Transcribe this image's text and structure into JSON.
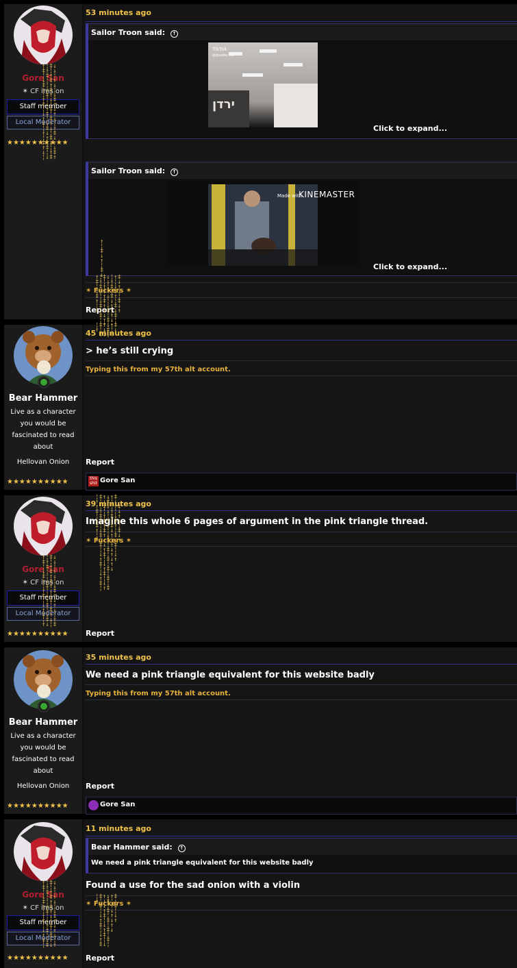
{
  "users": {
    "gore": {
      "name": "Gore San",
      "title": "CF ims on",
      "staff": "Staff member",
      "mod": "Local Moderator",
      "stars": "★★★★★★★★★★"
    },
    "bear": {
      "name": "Bear Hammer",
      "title_lines": [
        "Live as a character",
        "you would be",
        "fascinated to read",
        "about"
      ],
      "rank": "Hellovan Onion",
      "stars": "★★★★★★★★★★"
    }
  },
  "posts": [
    {
      "time": "53 minutes ago",
      "quotes": [
        {
          "author": "Sailor Troon said:",
          "expand": "Click to expand..."
        },
        {
          "author": "Sailor Troon said:",
          "expand": "Click to expand..."
        }
      ],
      "reaction": "✶ Fuckers ✶",
      "report": "Report"
    },
    {
      "time": "45 minutes ago",
      "body": "> he’s still crying",
      "signature": "Typing this from my 57th alt account.",
      "report": "Report",
      "reacted_by": "Gore San"
    },
    {
      "time": "39 minutes ago",
      "body": "Imagine this whole 6 pages of argument in the pink triangle thread.",
      "reaction": "✶ Fuckers ✶",
      "report": "Report"
    },
    {
      "time": "35 minutes ago",
      "body": "We need a pink triangle equivalent for this website badly",
      "signature": "Typing this from my 57th alt account.",
      "report": "Report",
      "reacted_by": "Gore San"
    },
    {
      "time": "11 minutes ago",
      "quote_author": "Bear Hammer said:",
      "quote_text": "We need a pink triangle equivalent for this website badly",
      "body": "Found a use for the sad onion with a violin",
      "reaction": "✶ Fuckers ✶",
      "report": "Report"
    }
  ],
  "video_overlay": "Made with KINEMASTER",
  "tiktok_label": "TikTok",
  "tiktok_handle": "@goalbe.hr1",
  "sign_text": "ירדן",
  "colors": {
    "accent": "#f0c24a",
    "line": "#2b2b8a",
    "gore_red": "#b21f2f"
  }
}
